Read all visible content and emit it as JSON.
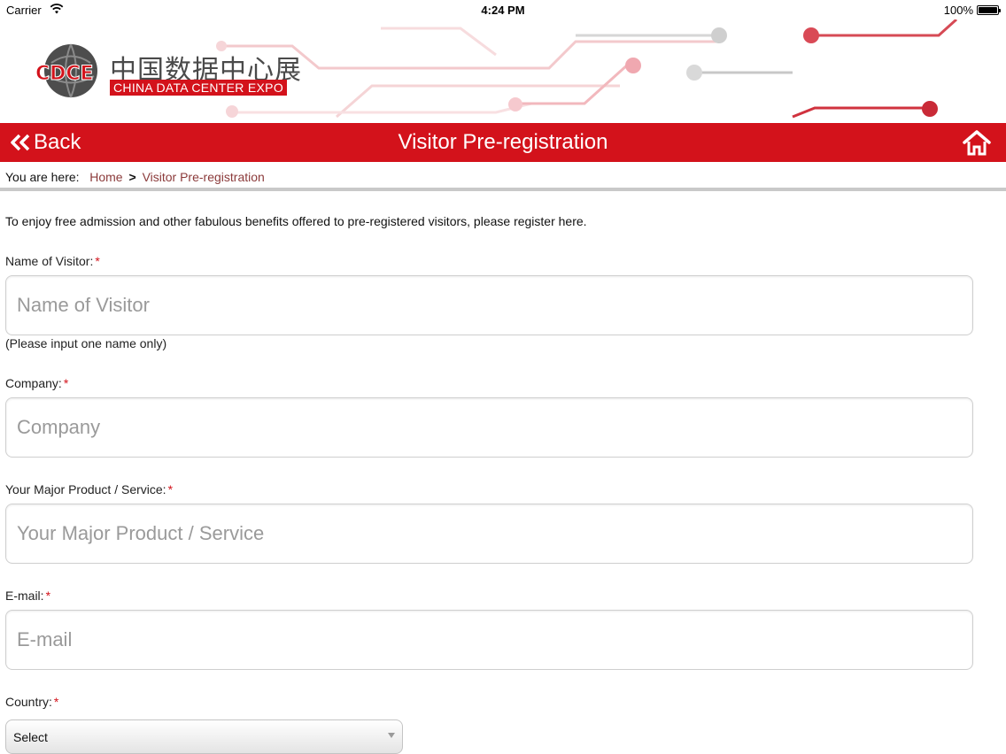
{
  "status_bar": {
    "carrier": "Carrier",
    "time": "4:24 PM",
    "battery": "100%"
  },
  "logo": {
    "mark_text": "CDCE",
    "chinese_name": "中国数据中心展",
    "english_name": "CHINA DATA CENTER EXPO"
  },
  "navbar": {
    "back_label": "Back",
    "title": "Visitor Pre-registration",
    "color": "#d3121b"
  },
  "breadcrumb": {
    "lead": "You are here:",
    "home": "Home",
    "separator": ">",
    "current": "Visitor Pre-registration"
  },
  "form": {
    "intro": "To enjoy free admission and other fabulous benefits offered to pre-registered visitors, please register here.",
    "required_mark": "*",
    "fields": {
      "name": {
        "label": "Name of Visitor:",
        "placeholder": "Name of Visitor",
        "hint": "(Please input one name only)"
      },
      "company": {
        "label": "Company:",
        "placeholder": "Company"
      },
      "product": {
        "label": "Your Major Product / Service:",
        "placeholder": "Your Major Product / Service"
      },
      "email": {
        "label": "E-mail:",
        "placeholder": "E-mail"
      },
      "country": {
        "label": "Country:",
        "selected": "Select"
      }
    }
  }
}
